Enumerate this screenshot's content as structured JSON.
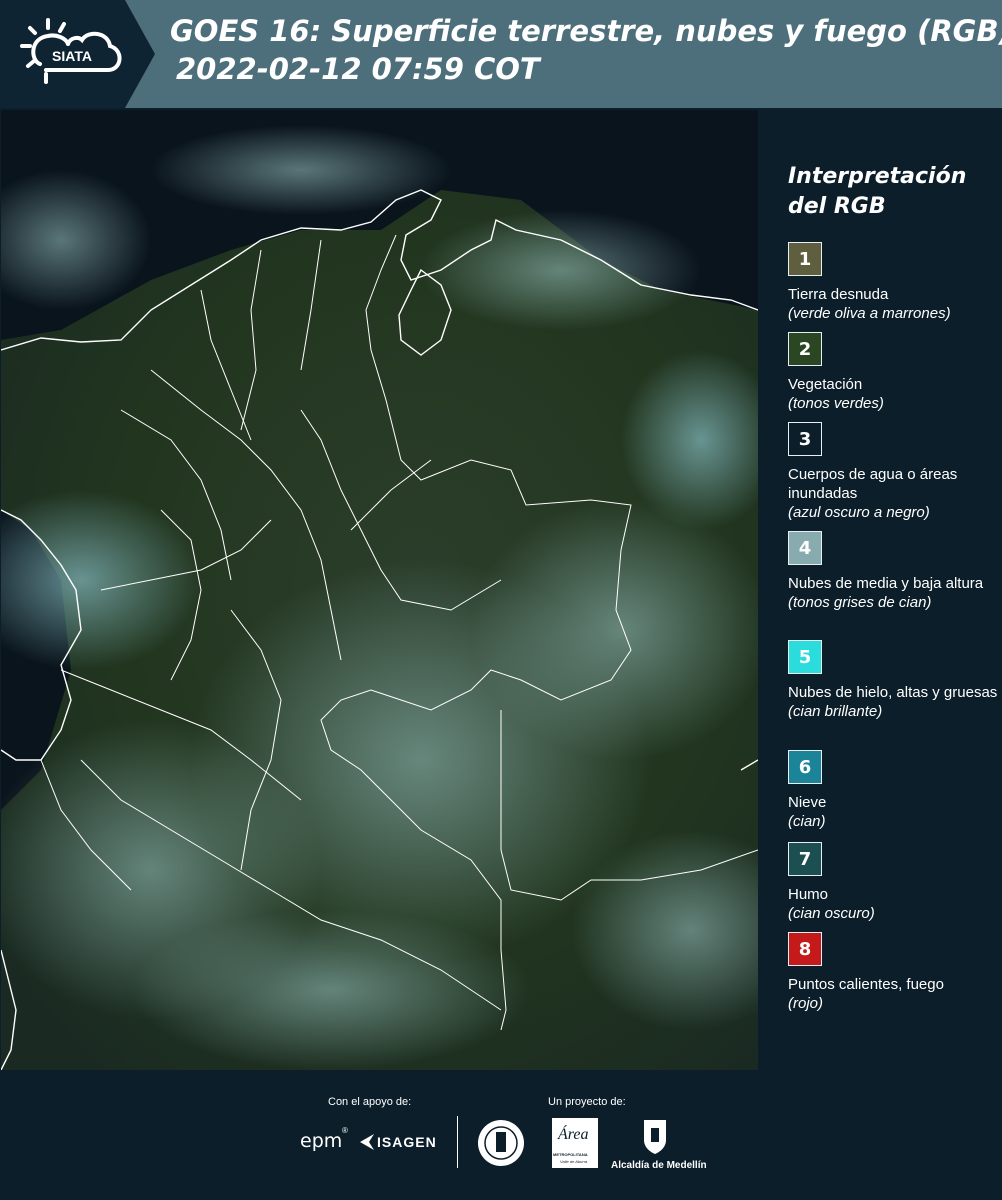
{
  "header": {
    "logo_text": "SIATA",
    "title_line1": "GOES 16: Superficie terrestre, nubes y fuego (RGB)",
    "title_line2": "2022-02-12 07:59 COT"
  },
  "colors": {
    "header_bg": "#4d6f7c",
    "logo_bg": "#0f2432",
    "page_bg": "#0c1e2a",
    "border_line": "#ffffff"
  },
  "legend": {
    "title_line1": "Interpretación",
    "title_line2": "del RGB",
    "items": [
      {
        "number": "1",
        "label": "Tierra desnuda",
        "note": "(verde oliva a marrones)",
        "color": "#5f5f3f"
      },
      {
        "number": "2",
        "label": "Vegetación",
        "note": "(tonos verdes)",
        "color": "#2a4622"
      },
      {
        "number": "3",
        "label": "Cuerpos de agua o áreas inundadas",
        "note": "(azul oscuro a negro)",
        "color": "#0c1e2a"
      },
      {
        "number": "4",
        "label": "Nubes de media y baja altura",
        "note": "(tonos grises de cian)",
        "color": "#87abae"
      },
      {
        "number": "5",
        "label": "Nubes de hielo, altas y gruesas",
        "note": "(cian brillante)",
        "color": "#2bdcdc"
      },
      {
        "number": "6",
        "label": "Nieve",
        "note": "(cian)",
        "color": "#1b8499"
      },
      {
        "number": "7",
        "label": "Humo",
        "note": "(cian oscuro)",
        "color": "#1c4f52"
      },
      {
        "number": "8",
        "label": "Puntos calientes, fuego",
        "note": "(rojo)",
        "color": "#c41a1a"
      }
    ]
  },
  "footer": {
    "support_caption": "Con el apoyo de:",
    "project_caption": "Un proyecto de:",
    "epm_logo": "epm",
    "isagen_logo": "ISAGEN",
    "area_logo_word": "Área",
    "area_logo_sub": "METROPOLITANA",
    "area_logo_sub2": "Valle de Aburrá",
    "alcaldia_label": "Alcaldía de Medellín"
  }
}
